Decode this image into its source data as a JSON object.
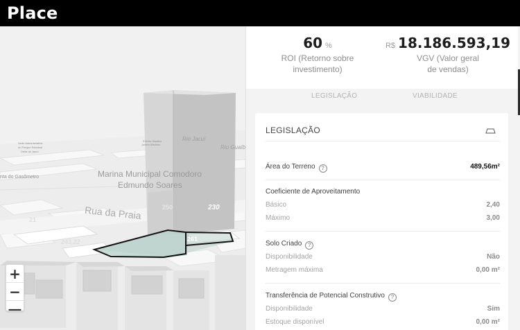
{
  "app": {
    "brand": "Place"
  },
  "map": {
    "labels": {
      "marina": "Marina Municipal Comodoro",
      "edmundo": "Edmundo Soares",
      "rua": "Rua da Praia",
      "gasometro": "nta do Gasômetro",
      "rio_jacui_1": "Rio Jacuí",
      "rio_jacui_2": "Rio Guaíb",
      "sede": "Sede Administrativa",
      "parque": "do Parque Estadual",
      "delta": "Delta do Jacuí",
      "evento1": "Evento Náutico",
      "evento2": "Jovem Marinho",
      "num_230": "230",
      "num_261": "261",
      "num_243": "243,22",
      "num_21": "21",
      "num_250": "250"
    },
    "zoom_in": "+",
    "zoom_out": "−",
    "compass": "—"
  },
  "kpis": {
    "roi_value": "60",
    "roi_unit": "%",
    "roi_caption_1": "ROI (Retorno sobre",
    "roi_caption_2": "investimento)",
    "vgv_currency": "R$",
    "vgv_value": "18.186.593,19",
    "vgv_caption_1": "VGV (Valor geral",
    "vgv_caption_2": "de vendas)"
  },
  "tabs": {
    "legislacao": "LEGISLAÇÃO",
    "viabilidade": "VIABILIDADE"
  },
  "card": {
    "title": "LEGISLAÇÃO",
    "help": "?",
    "area_label": "Área do Terreno",
    "area_value": "489,56m²",
    "coef_title": "Coeficiente de Aproveitamento",
    "basico_label": "Básico",
    "basico_value": "2,40",
    "maximo_label": "Máximo",
    "maximo_value": "3,00",
    "solo_title": "Solo Criado",
    "solo_disp_label": "Disponibilidade",
    "solo_disp_value": "Não",
    "solo_metr_label": "Metragem máxima",
    "solo_metr_value": "0,00 m²",
    "transf_title": "Transferência de Potencial Construtivo",
    "transf_disp_label": "Disponibilidade",
    "transf_disp_value": "Sim",
    "transf_est_label": "Estoque disponível",
    "transf_est_value": "0,00 m²"
  }
}
